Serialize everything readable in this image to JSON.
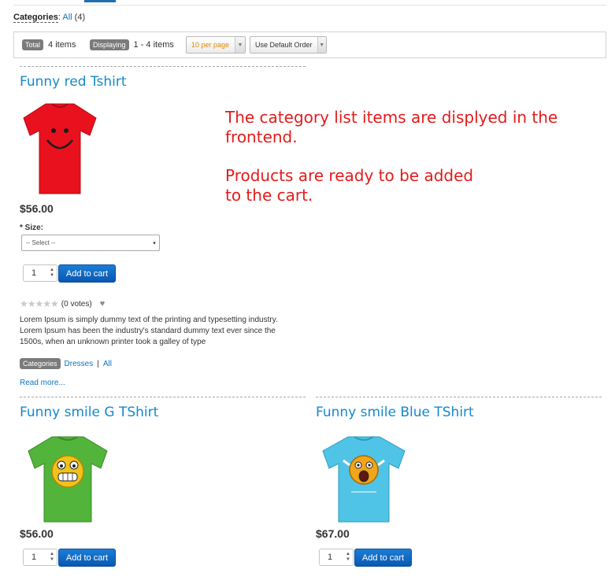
{
  "filter": {
    "label": "Categories",
    "all_link": "All",
    "count": "(4)"
  },
  "toolbar": {
    "total_badge": "Total",
    "total_value": "4 items",
    "displaying_badge": "Displaying",
    "displaying_value": "1 - 4 items",
    "per_page": "10 per page",
    "order": "Use Default Order"
  },
  "annotation": {
    "line1": "The category list items are displyed in the\nfrontend.",
    "line2": "Products are ready to be added\nto the cart."
  },
  "products": [
    {
      "title": "Funny red Tshirt",
      "price": "$56.00",
      "size_label": "* Size:",
      "size_placeholder": "-- Select --",
      "qty": "1",
      "cart_label": "Add to cart",
      "votes": "(0 votes)",
      "description": "Lorem Ipsum is simply dummy text of the printing and typesetting industry. Lorem Ipsum has been the industry's standard dummy text ever since the 1500s, when an unknown printer took a galley of type",
      "categories_badge": "Categories",
      "cat_link_1": "Dresses",
      "cat_sep": "|",
      "cat_link_2": "All",
      "read_more": "Read more...",
      "shirt_color": "#e8111d"
    },
    {
      "title": "Funny smile G TShirt",
      "price": "$56.00",
      "qty": "1",
      "cart_label": "Add to cart",
      "shirt_color": "#52b43a"
    },
    {
      "title": "Funny smile Blue TShirt",
      "price": "$67.00",
      "qty": "1",
      "cart_label": "Add to cart",
      "shirt_color": "#4fc4e6"
    }
  ],
  "colors": {
    "link": "#0a74c4",
    "title": "#1589c9",
    "button": "#0a57b0",
    "annotation": "#e41b1b"
  }
}
